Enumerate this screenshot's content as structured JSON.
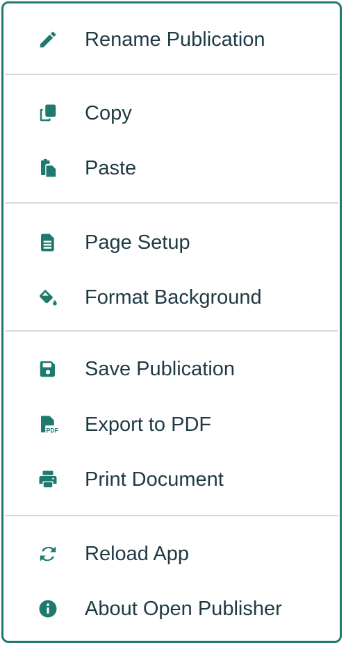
{
  "colors": {
    "accent": "#1f7a6d",
    "text": "#1e3a44",
    "divider": "#d9d9d9"
  },
  "menu": {
    "items": [
      {
        "label": "Rename Publication",
        "icon": "pencil-icon"
      },
      {
        "label": "Copy",
        "icon": "copy-icon"
      },
      {
        "label": "Paste",
        "icon": "paste-icon"
      },
      {
        "label": "Page Setup",
        "icon": "page-setup-icon"
      },
      {
        "label": "Format Background",
        "icon": "paint-bucket-icon"
      },
      {
        "label": "Save Publication",
        "icon": "save-icon"
      },
      {
        "label": "Export to PDF",
        "icon": "pdf-file-icon"
      },
      {
        "label": "Print Document",
        "icon": "printer-icon"
      },
      {
        "label": "Reload App",
        "icon": "reload-icon"
      },
      {
        "label": "About Open Publisher",
        "icon": "info-icon"
      }
    ]
  }
}
